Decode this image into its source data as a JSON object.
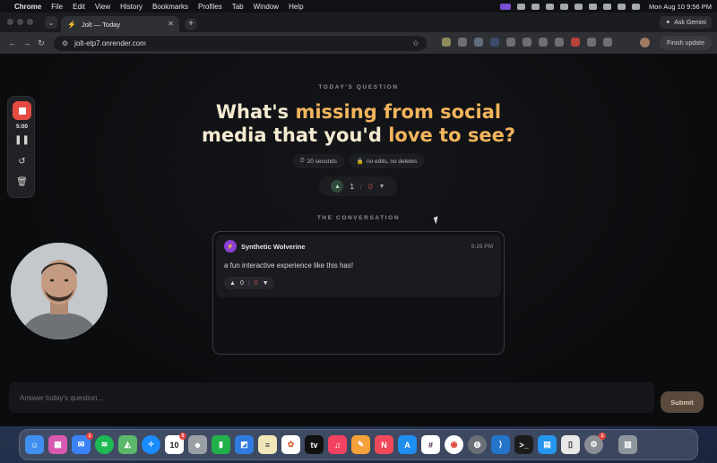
{
  "menubar": {
    "app": "Chrome",
    "items": [
      "File",
      "Edit",
      "View",
      "History",
      "Bookmarks",
      "Profiles",
      "Tab",
      "Window",
      "Help"
    ],
    "clock": "Mon Aug 10  9:56 PM"
  },
  "browser": {
    "tab_title": "Jolt — Today",
    "ask_gemini": "Ask Gemini",
    "url": "jolt-etp7.onrender.com",
    "finish_update": "Finish update"
  },
  "page": {
    "eyebrow_question": "TODAY'S QUESTION",
    "question_line1_a": "What's ",
    "question_line1_b": "missing from social",
    "question_line2_a": "media that you'd ",
    "question_line2_b": "love to see?",
    "chips": [
      {
        "icon": "⏱",
        "label": "20 seconds"
      },
      {
        "icon": "🔒",
        "label": "no edits, no deletes"
      }
    ],
    "votes": {
      "up": "1",
      "separator": "/",
      "down": "0"
    },
    "eyebrow_conversation": "THE CONVERSATION",
    "answer": {
      "author": "Synthetic Wolverine",
      "time": "9:29 PM",
      "text": "a fun interactive experience like this has!",
      "up": "0",
      "separator": "/",
      "down": "0"
    },
    "input_placeholder": "Answer today's question...",
    "submit_label": "Submit"
  },
  "recorder": {
    "time": "5:00"
  },
  "dock": {
    "mail_badge": "1",
    "calendar_badge": "5",
    "calendar_day": "10",
    "last_badge": "1"
  },
  "colors": {
    "accent_gold": "#f2b45c",
    "record_red": "#e44b43",
    "downvote_red": "#c0504d"
  }
}
